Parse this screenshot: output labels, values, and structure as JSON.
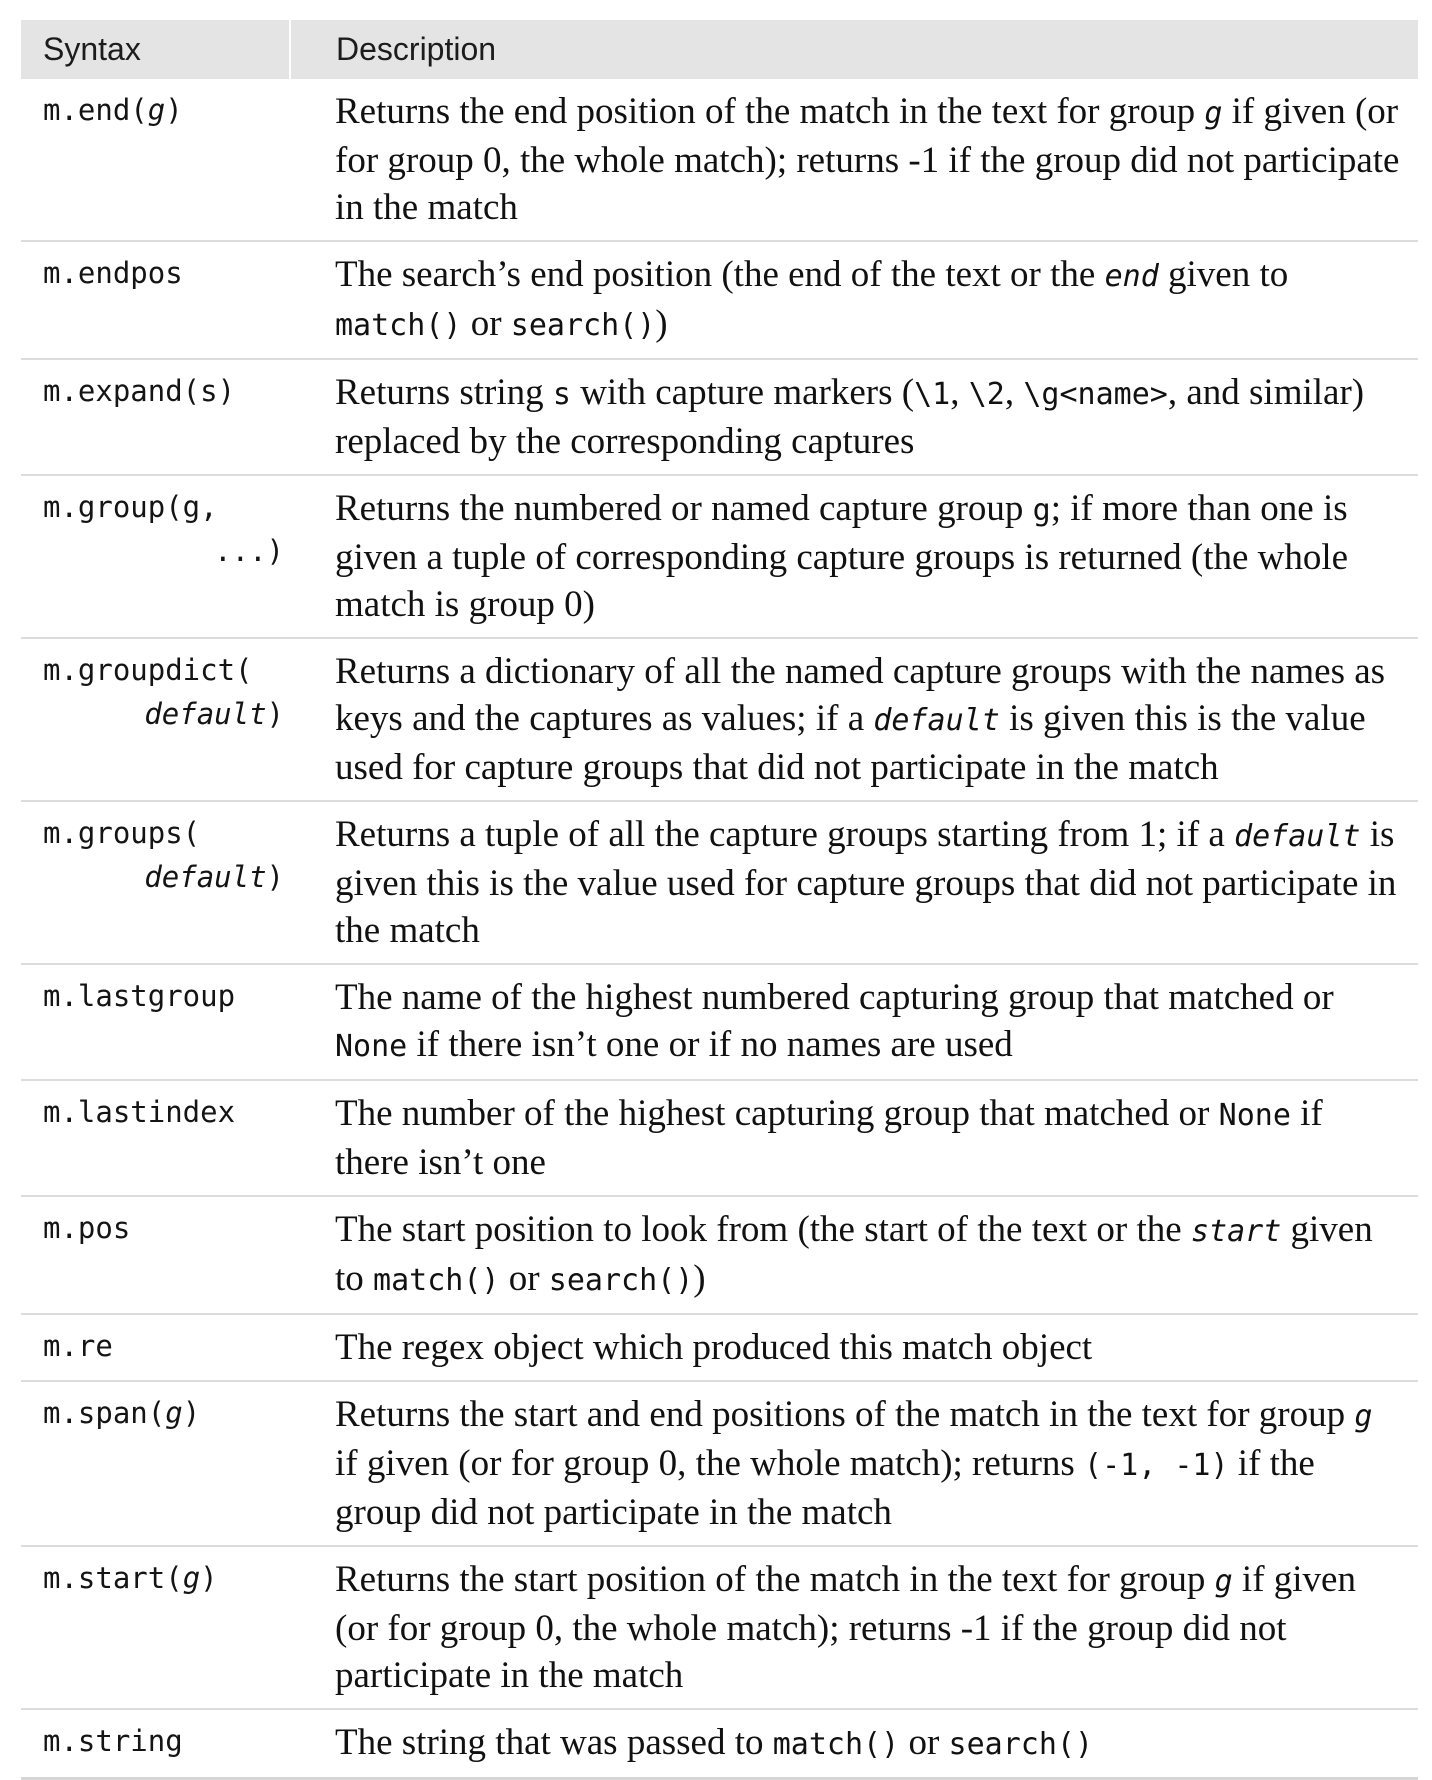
{
  "header": {
    "syntax": "Syntax",
    "description": "Description"
  },
  "rows": [
    {
      "syntax": [
        "m.end(",
        "g",
        ")"
      ],
      "desc": {
        "a": "Returns the end position of the match in the text for group ",
        "b": "g",
        "c": " if given (or for group 0, the whole match); returns -1 if the group did not participate in the match"
      }
    },
    {
      "syntax": "m.endpos",
      "desc": {
        "a": "The search’s end position (the end of the text or the ",
        "b": "end",
        "c": " given to ",
        "d": "match()",
        "e": " or ",
        "f": "search()",
        "g": ")"
      }
    },
    {
      "syntax": "m.expand(s)",
      "desc": {
        "a": "Returns string ",
        "b": "s",
        "c": " with capture markers (",
        "d": "\\1",
        "e": ", ",
        "f": "\\2",
        "g": ", ",
        "h": "\\g<name>",
        "i": ", and similar) replaced by the corresponding captures"
      }
    },
    {
      "syntax": [
        "m.group(g,",
        "...)"
      ],
      "desc": {
        "a": "Returns the numbered or named capture group ",
        "b": "g",
        "c": "; if more than one is given a tuple of corresponding capture groups is returned (the whole match is group 0)"
      }
    },
    {
      "syntax": [
        "m.groupdict(",
        "default",
        ")"
      ],
      "desc": {
        "a": "Returns a dictionary of all the named capture groups with the names as keys and the captures as values; if a ",
        "b": "default",
        "c": " is given this is the value used for capture groups that did not participate in the match"
      }
    },
    {
      "syntax": [
        "m.groups(",
        "default",
        ")"
      ],
      "desc": {
        "a": "Returns a tuple of all the capture groups starting from 1; if a ",
        "b": "default",
        "c": " is given this is the value used for capture groups that did not participate in the match"
      }
    },
    {
      "syntax": "m.lastgroup",
      "desc": {
        "a": "The name of the highest numbered capturing group that matched or ",
        "b": "None",
        "c": " if there isn’t one or if no names are used"
      }
    },
    {
      "syntax": "m.lastindex",
      "desc": {
        "a": "The number of the highest capturing group that matched or ",
        "b": "None",
        "c": " if there isn’t one"
      }
    },
    {
      "syntax": "m.pos",
      "desc": {
        "a": "The start position to look from (the start of the text or the ",
        "b": "start",
        "c": " given to ",
        "d": "match()",
        "e": " or ",
        "f": "search()",
        "g": ")"
      }
    },
    {
      "syntax": "m.re",
      "desc": {
        "a": "The regex object which produced this match object"
      }
    },
    {
      "syntax": [
        "m.span(",
        "g",
        ")"
      ],
      "desc": {
        "a": "Returns the start and end positions of the match in the text for group ",
        "b": "g",
        "c": " if given (or for group 0, the whole match); returns ",
        "d": "(-1, -1)",
        "e": " if the group did not participate in the match"
      }
    },
    {
      "syntax": [
        "m.start(",
        "g",
        ")"
      ],
      "desc": {
        "a": "Returns the start position of the match in the text for group ",
        "b": "g",
        "c": " if given (or for group 0, the whole match); returns -1 if the group did not participate in the match"
      }
    },
    {
      "syntax": "m.string",
      "desc": {
        "a": "The string that was passed to ",
        "b": "match()",
        "c": " or ",
        "d": "search()"
      }
    }
  ]
}
